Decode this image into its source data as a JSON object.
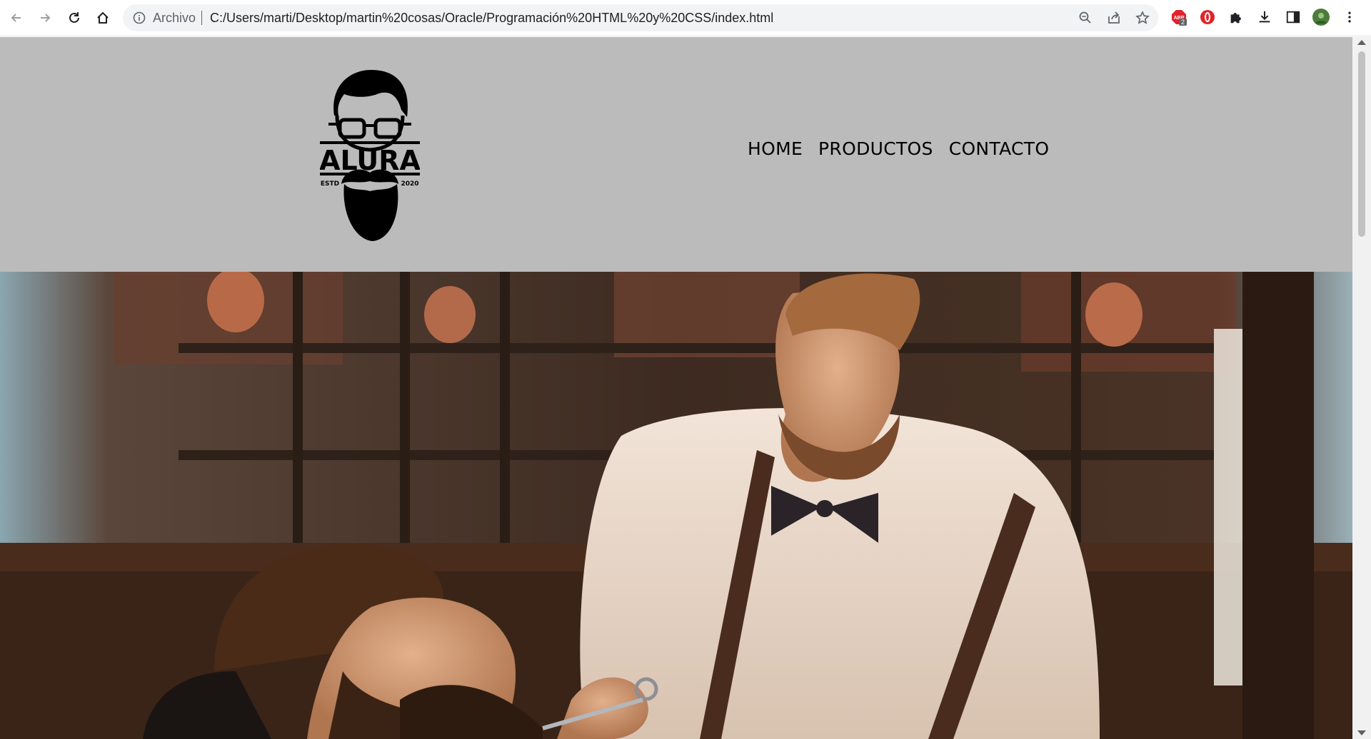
{
  "browser": {
    "scheme_label": "Archivo",
    "url": "C:/Users/marti/Desktop/martin%20cosas/Oracle/Programación%20HTML%20y%20CSS/index.html",
    "extensions": [
      {
        "name": "adblock-icon",
        "badge": "2"
      },
      {
        "name": "opera-icon"
      },
      {
        "name": "puzzle-icon"
      },
      {
        "name": "download-icon"
      },
      {
        "name": "sidepanel-icon"
      },
      {
        "name": "avatar"
      }
    ]
  },
  "site": {
    "logo": {
      "brand": "ALURA",
      "left_text": "ESTD",
      "right_text": "2020"
    },
    "menu": [
      {
        "label": "HOME"
      },
      {
        "label": "PRODUCTOS"
      },
      {
        "label": "CONTACTO"
      }
    ],
    "header_bg": "#bbbbbb"
  }
}
